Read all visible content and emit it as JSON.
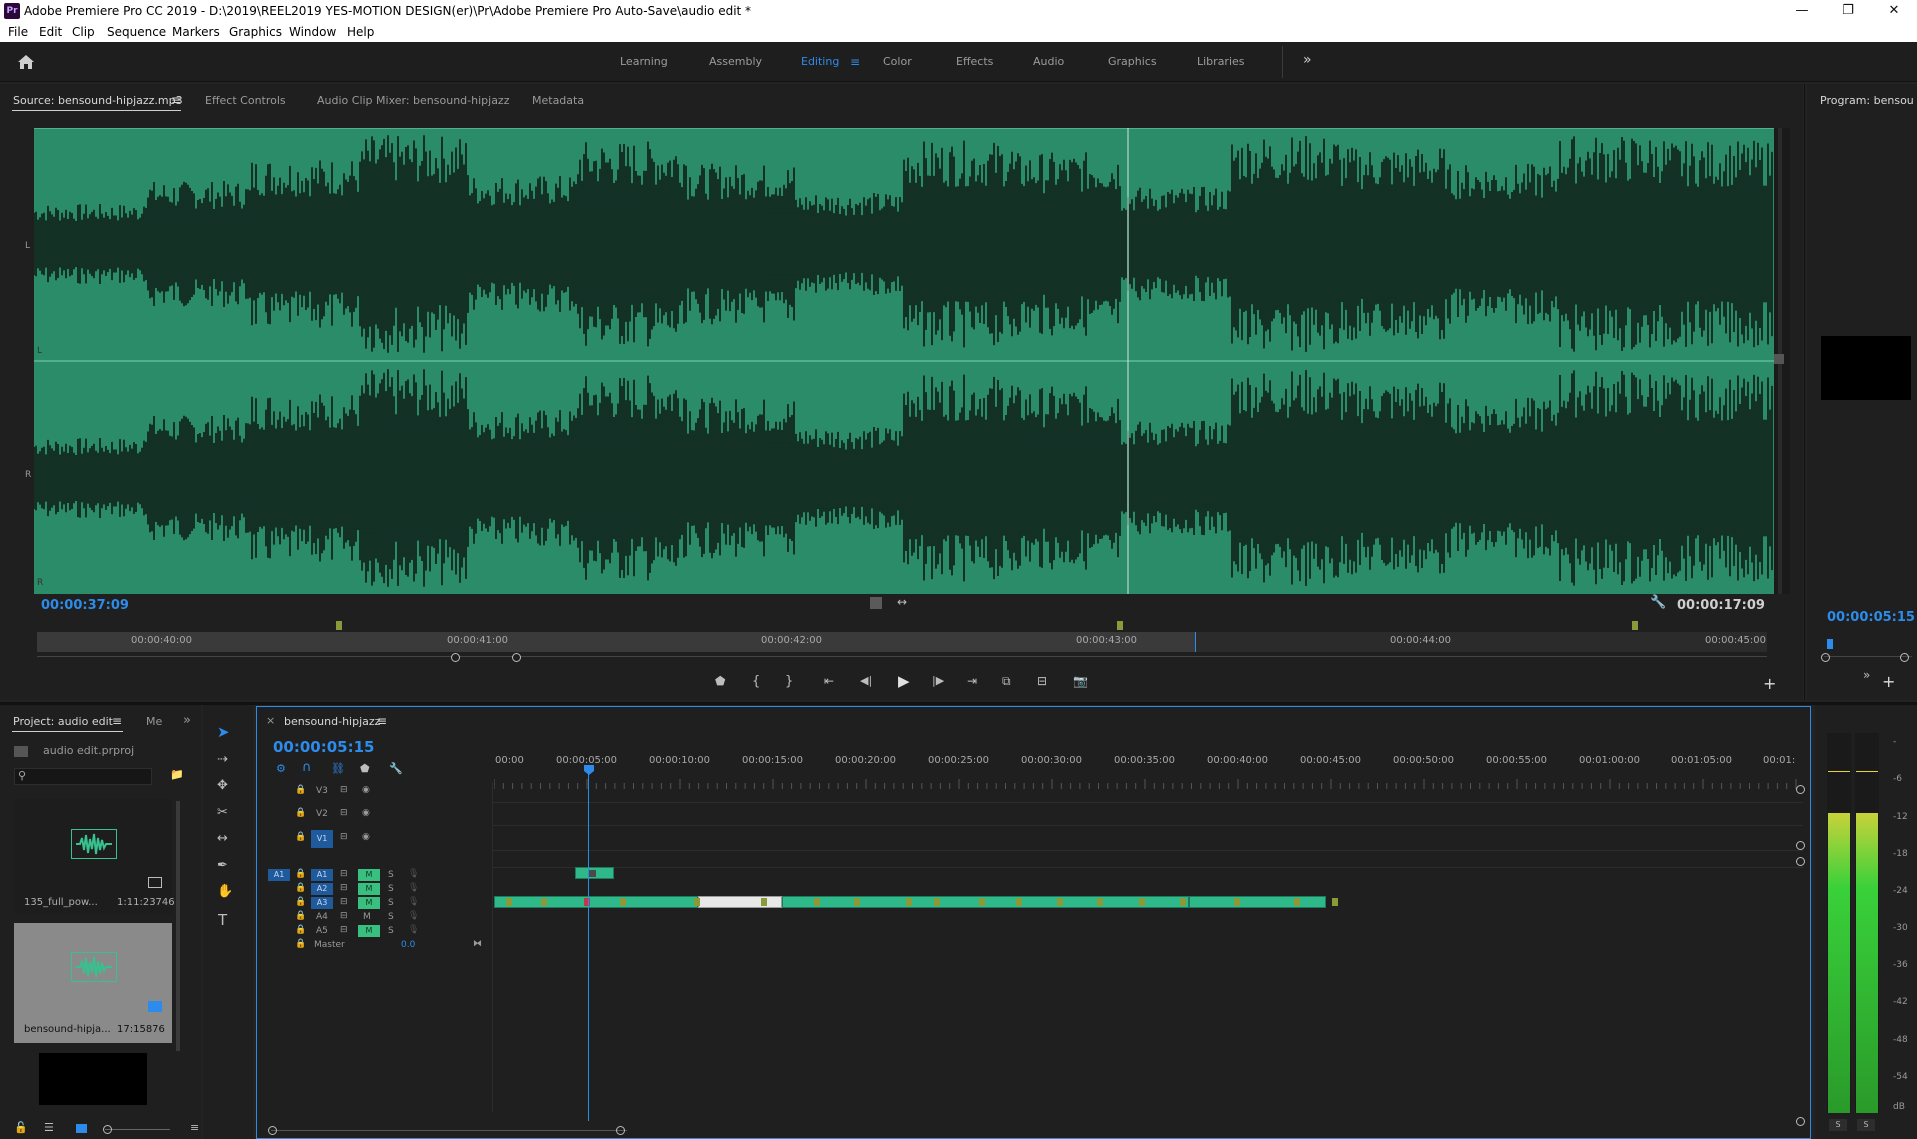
{
  "window": {
    "title": "Adobe Premiere Pro CC 2019 - D:\\2019\\REEL2019 YES-MOTION DESIGN(er)\\Pr\\Adobe Premiere Pro Auto-Save\\audio edit *",
    "app_badge": "Pr"
  },
  "menu": [
    "File",
    "Edit",
    "Clip",
    "Sequence",
    "Markers",
    "Graphics",
    "Window",
    "Help"
  ],
  "workspaces": [
    "Learning",
    "Assembly",
    "Editing",
    "Color",
    "Effects",
    "Audio",
    "Graphics",
    "Libraries"
  ],
  "active_workspace": "Editing",
  "source_panel": {
    "tabs": [
      "Source: bensound-hipjazz.mp3",
      "Effect Controls",
      "Audio Clip Mixer: bensound-hipjazz",
      "Metadata"
    ],
    "channel_labels": [
      "L",
      "L",
      "R",
      "R"
    ],
    "timecode_left": "00:00:37:09",
    "timecode_right": "00:00:17:09",
    "ruler_labels": [
      "00:00:40:00",
      "00:00:41:00",
      "00:00:42:00",
      "00:00:43:00",
      "00:00:44:00",
      "00:00:45:00"
    ],
    "waveform_color": "#2a8c68"
  },
  "program_panel": {
    "tab": "Program: bensou",
    "timecode": "00:00:05:15"
  },
  "project_panel": {
    "tab": "Project: audio edit",
    "tab2": "Me",
    "project_file": "audio edit.prproj",
    "items": [
      {
        "name": "135_full_pow...",
        "duration": "1:11:23746"
      },
      {
        "name": "bensound-hipja...",
        "duration": "17:15876"
      }
    ]
  },
  "timeline": {
    "tab": "bensound-hipjazz",
    "timecode": "00:00:05:15",
    "ruler_labels": [
      "00:00",
      "00:00:05:00",
      "00:00:10:00",
      "00:00:15:00",
      "00:00:20:00",
      "00:00:25:00",
      "00:00:30:00",
      "00:00:35:00",
      "00:00:40:00",
      "00:00:45:00",
      "00:00:50:00",
      "00:00:55:00",
      "00:01:00:00",
      "00:01:05:00",
      "00:01:"
    ],
    "video_tracks": [
      "V3",
      "V2",
      "V1"
    ],
    "audio_tracks": [
      "A1",
      "A2",
      "A3",
      "A4",
      "A5"
    ],
    "source_patch": "A1",
    "master_label": "Master",
    "master_value": "0.0",
    "mute_label": "M",
    "solo_label": "S"
  },
  "meter": {
    "scale": [
      "-",
      "-6",
      "-12",
      "-18",
      "-24",
      "-30",
      "-36",
      "-42",
      "-48",
      "-54",
      "dB"
    ],
    "solo_labels": [
      "S",
      "S"
    ]
  },
  "colors": {
    "accent": "#2d8ceb",
    "clip_green": "#2fb88a",
    "clip_white": "#e8e8e8",
    "marker_olive": "#8a9a3a",
    "meter_green": "#39d13a"
  }
}
